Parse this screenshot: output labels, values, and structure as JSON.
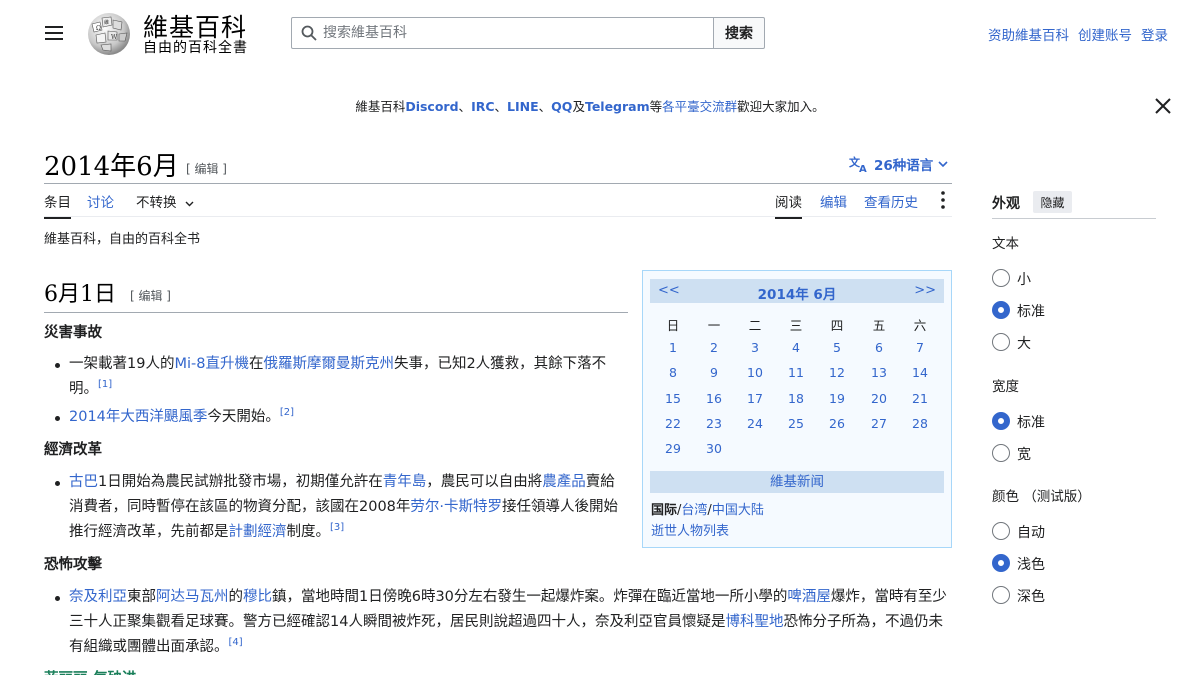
{
  "header": {
    "logo_title": "維基百科",
    "logo_tagline": "自由的百科全書",
    "search_placeholder": "搜索維基百科",
    "search_button": "搜索",
    "user_links": [
      "资助維基百科",
      "创建账号",
      "登录"
    ]
  },
  "banner": {
    "parts": [
      {
        "text": "維基百科",
        "link": false
      },
      {
        "text": "Discord",
        "link": true
      },
      {
        "text": "、",
        "link": false
      },
      {
        "text": "IRC",
        "link": true
      },
      {
        "text": "、",
        "link": false
      },
      {
        "text": "LINE",
        "link": true
      },
      {
        "text": "、",
        "link": false
      },
      {
        "text": "QQ",
        "link": true
      },
      {
        "text": "及",
        "link": false
      },
      {
        "text": "Telegram",
        "link": true
      },
      {
        "text": "等",
        "link": false
      },
      {
        "text": "各平臺交流群",
        "link": true
      },
      {
        "text": "歡迎大家加入。",
        "link": false
      }
    ]
  },
  "page": {
    "title": "2014年6月",
    "edit_label": "[ 编辑 ]",
    "languages": "26种语言",
    "tagline": "維基百科，自由的百科全书"
  },
  "tabs": {
    "article": "条目",
    "talk": "讨论",
    "variant": "不转换",
    "read": "阅读",
    "edit": "编辑",
    "history": "查看历史"
  },
  "content": {
    "section_title": "6月1日",
    "section_edit": "[ 编辑 ]",
    "sub_disaster": "災害事故",
    "sub_economy": "經濟改革",
    "sub_terror": "恐怖攻擊",
    "sub_next_partial": "菲丽丽·气殃进"
  },
  "calendar": {
    "prev": "<<",
    "title": "2014年 6月",
    "next": ">>",
    "weekdays": [
      "日",
      "一",
      "二",
      "三",
      "四",
      "五",
      "六"
    ],
    "days": [
      "1",
      "2",
      "3",
      "4",
      "5",
      "6",
      "7",
      "8",
      "9",
      "10",
      "11",
      "12",
      "13",
      "14",
      "15",
      "16",
      "17",
      "18",
      "19",
      "20",
      "21",
      "22",
      "23",
      "24",
      "25",
      "26",
      "27",
      "28",
      "29",
      "30"
    ],
    "news_header": "維基新闻",
    "line1_bold": "国际",
    "line1_sep1": "/",
    "line1_link1": "台湾",
    "line1_sep2": "/",
    "line1_link2": "中国大陆",
    "line2": "逝世人物列表"
  },
  "appearance": {
    "title": "外观",
    "hide": "隐藏",
    "text_label": "文本",
    "text_options": [
      "小",
      "标准",
      "大"
    ],
    "text_selected": 1,
    "width_label": "宽度",
    "width_options": [
      "标准",
      "宽"
    ],
    "width_selected": 0,
    "color_label": "颜色 （测试版）",
    "color_options": [
      "自动",
      "浅色",
      "深色"
    ],
    "color_selected": 1
  },
  "colors": {
    "link": "#3366cc",
    "text": "#202122",
    "calendar_head": "#cee0f2",
    "calendar_border": "#a7d7f9"
  }
}
